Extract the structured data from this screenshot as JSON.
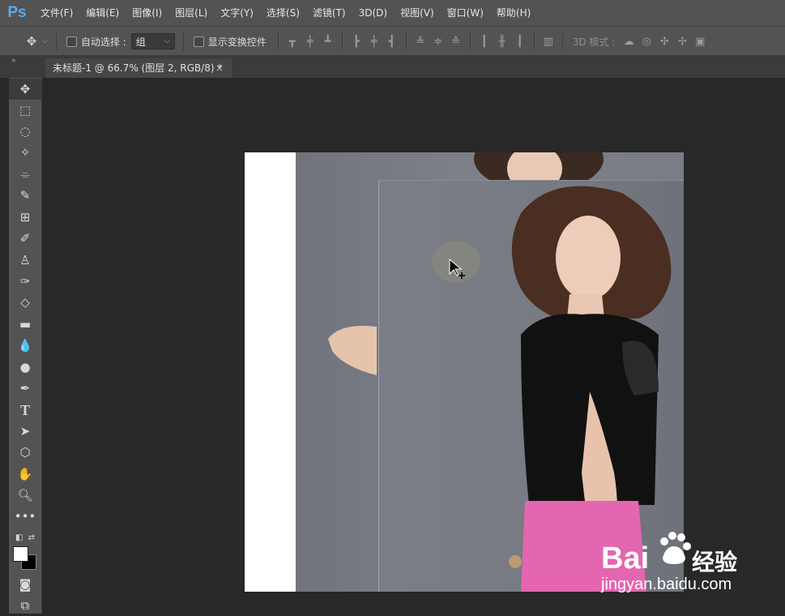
{
  "app": {
    "logo": "Ps"
  },
  "menu": [
    "文件(F)",
    "编辑(E)",
    "图像(I)",
    "图层(L)",
    "文字(Y)",
    "选择(S)",
    "滤镜(T)",
    "3D(D)",
    "视图(V)",
    "窗口(W)",
    "帮助(H)"
  ],
  "options": {
    "auto_select_label": "自动选择 :",
    "auto_select_value": "组",
    "show_transform_label": "显示变换控件",
    "mode_3d_label": "3D 模式 :"
  },
  "document": {
    "tab_title": "未标题-1 @ 66.7% (图层 2, RGB/8) *",
    "close_glyph": "×"
  },
  "watermark": {
    "brand": "Bai",
    "brand_suffix": "经验",
    "url": "jingyan.baidu.com"
  },
  "colors": {
    "fg": "#ffffff",
    "bg": "#000000",
    "accent": "#5aa9ec"
  }
}
